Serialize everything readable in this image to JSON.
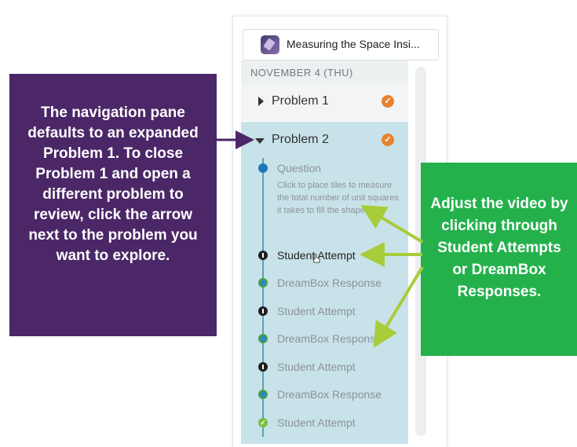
{
  "header": {
    "title": "Measuring the Space Insi..."
  },
  "date_label": "NOVEMBER 4 (THU)",
  "problems": [
    {
      "label": "Problem 1",
      "status": "✓"
    },
    {
      "label": "Problem 2",
      "status": "✓"
    }
  ],
  "question": {
    "label": "Question",
    "description": "Click to place tiles to measure the total number of unit squares it takes to fill the shape."
  },
  "events": [
    {
      "label": "Student Attempt",
      "icon": "pin-icon"
    },
    {
      "label": "DreamBox Response",
      "icon": "dreambox-icon"
    },
    {
      "label": "Student Attempt",
      "icon": "pin-icon"
    },
    {
      "label": "DreamBox Response",
      "icon": "dreambox-icon"
    },
    {
      "label": "Student Attempt",
      "icon": "pin-icon"
    },
    {
      "label": "DreamBox Response",
      "icon": "dreambox-icon"
    },
    {
      "label": "Student Attempt",
      "icon": "green-check-icon"
    }
  ],
  "callouts": {
    "purple": "The navigation pane defaults to an expanded Problem 1. To close Problem 1 and open a different problem to review, click the arrow next to the problem you want to explore.",
    "green": "Adjust the video by clicking through Student Attempts or DreamBox Responses."
  },
  "colors": {
    "accent_orange": "#e8822e",
    "selected_row": "#c8e2e9",
    "purple_callout": "#4b2767",
    "green_callout": "#24b14c",
    "arrow_green": "#a8cc3a"
  }
}
